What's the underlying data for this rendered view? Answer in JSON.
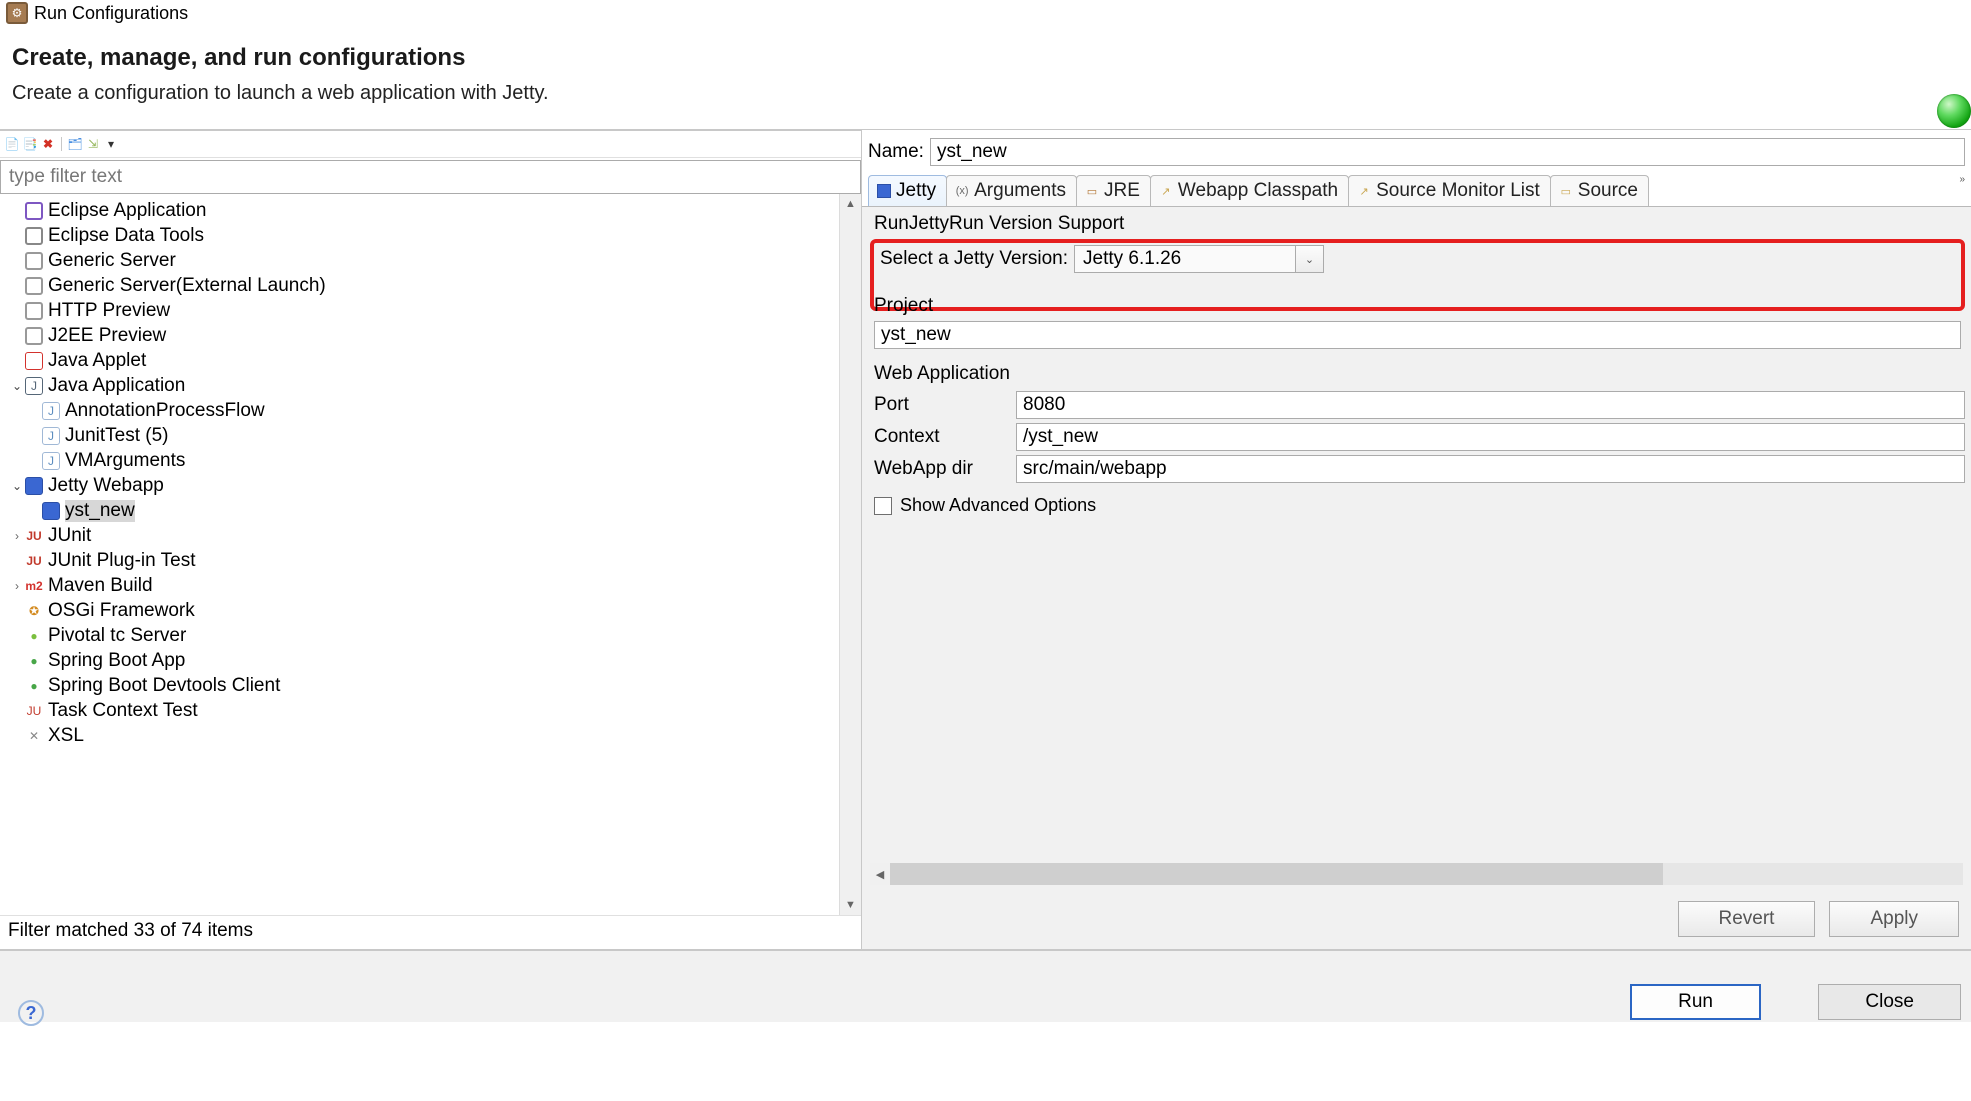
{
  "title": "Run Configurations",
  "header": {
    "heading": "Create, manage, and run configurations",
    "subheading": "Create a configuration to launch a web application with Jetty."
  },
  "filterPlaceholder": "type filter text",
  "filterStatus": "Filter matched 33 of 74 items",
  "tree": {
    "eclipse_app": "Eclipse Application",
    "eclipse_data_tools": "Eclipse Data Tools",
    "generic_server": "Generic Server",
    "generic_server_ext": "Generic Server(External Launch)",
    "http_preview": "HTTP Preview",
    "j2ee_preview": "J2EE Preview",
    "java_applet": "Java Applet",
    "java_application": "Java Application",
    "annotation_flow": "AnnotationProcessFlow",
    "junit_test_5": "JunitTest (5)",
    "vm_arguments": "VMArguments",
    "jetty_webapp": "Jetty Webapp",
    "yst_new": "yst_new",
    "junit": "JUnit",
    "junit_plugin": "JUnit Plug-in Test",
    "maven_build": "Maven Build",
    "osgi": "OSGi Framework",
    "pivotal": "Pivotal tc Server",
    "spring_boot": "Spring Boot App",
    "spring_devtools": "Spring Boot Devtools Client",
    "task_context": "Task Context Test",
    "xsl": "XSL"
  },
  "form": {
    "nameLabel": "Name:",
    "nameValue": "yst_new",
    "tabs": {
      "jetty": "Jetty",
      "arguments": "Arguments",
      "jre": "JRE",
      "classpath": "Webapp Classpath",
      "monitor": "Source Monitor List",
      "source": "Source"
    },
    "versionGroup": "RunJettyRun Version Support",
    "versionLabel": "Select a Jetty Version:",
    "versionValue": "Jetty 6.1.26",
    "projectLabel": "Project",
    "projectValue": "yst_new",
    "webAppLabel": "Web Application",
    "portLabel": "Port",
    "portValue": "8080",
    "contextLabel": "Context",
    "contextValue": "/yst_new",
    "webappDirLabel": "WebApp dir",
    "webappDirValue": "src/main/webapp",
    "advancedLabel": "Show Advanced Options",
    "revert": "Revert",
    "apply": "Apply"
  },
  "footer": {
    "run": "Run",
    "close": "Close"
  }
}
